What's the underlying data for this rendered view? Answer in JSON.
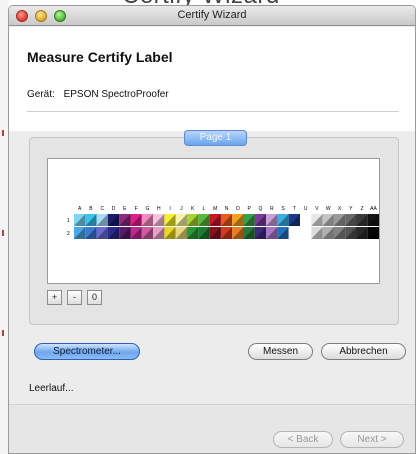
{
  "window": {
    "title": "Certify Wizard"
  },
  "header": {
    "title": "Measure Certify Label",
    "device_label": "Gerät:",
    "device_name": "EPSON SpectroProofer"
  },
  "page_tab": {
    "label": "Page 1"
  },
  "chart": {
    "columns": [
      "A",
      "B",
      "C",
      "D",
      "E",
      "F",
      "G",
      "H",
      "I",
      "J",
      "K",
      "L",
      "M",
      "N",
      "O",
      "P",
      "Q",
      "R",
      "S",
      "T",
      "U",
      "V",
      "W",
      "X",
      "Y",
      "Z",
      "AA"
    ],
    "rows": [
      "1",
      "2"
    ],
    "column_colors": [
      [
        "#7fd6f4",
        "#4aa7e8"
      ],
      [
        "#3cc2ec",
        "#3c79d4"
      ],
      [
        "#a6dcf5",
        "#6a6ad6"
      ],
      [
        "#1c1c6c",
        "#2a2a8c"
      ],
      [
        "#8a2a78",
        "#5a1a6a"
      ],
      [
        "#e0208a",
        "#ba2a8c"
      ],
      [
        "#f08ac0",
        "#d05aa0"
      ],
      [
        "#f6c2dc",
        "#e6a0c8"
      ],
      [
        "#f4ef30",
        "#e8d820"
      ],
      [
        "#f6f4a8",
        "#e8d87c"
      ],
      [
        "#a6d630",
        "#2a9a38"
      ],
      [
        "#5ab83c",
        "#1c7c30"
      ],
      [
        "#c41a2a",
        "#8a1020"
      ],
      [
        "#e85a20",
        "#d03a20"
      ],
      [
        "#f4a020",
        "#ec7c20"
      ],
      [
        "#38a04a",
        "#267a3a"
      ],
      [
        "#7c3c9c",
        "#3c2a7c"
      ],
      [
        "#c8a0d8",
        "#a878c8"
      ],
      [
        "#3ab0e0",
        "#2670c0"
      ],
      [
        "#1a3a8a",
        "#ffffff"
      ],
      [
        "#ffffff",
        "#ffffff"
      ],
      [
        "#e8e8e8",
        "#dcdcdc"
      ],
      [
        "#c4c4c4",
        "#b0b0b0"
      ],
      [
        "#9a9a9a",
        "#828282"
      ],
      [
        "#6a6a6a",
        "#545454"
      ],
      [
        "#3a3a3a",
        "#2a2a2a"
      ],
      [
        "#141414",
        "#060606"
      ]
    ]
  },
  "zoom": {
    "in_label": "+",
    "out_label": "-",
    "reset_label": "0"
  },
  "actions": {
    "spectrometer_label": "Spectrometer...",
    "measure_label": "Messen",
    "cancel_label": "Abbrechen"
  },
  "status": {
    "text": "Leerlauf..."
  },
  "navigation": {
    "back_label": "< Back",
    "next_label": "Next >"
  },
  "colors": {
    "accent": "#6ea7ee",
    "panel_background": "#ececec"
  }
}
